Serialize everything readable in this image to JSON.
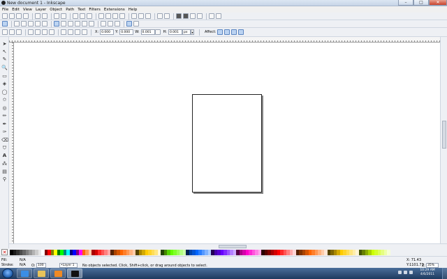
{
  "window": {
    "title": "New document 1 - Inkscape",
    "buttons": {
      "minimize": "–",
      "maximize": "□",
      "close": "✕"
    }
  },
  "menu": [
    "File",
    "Edit",
    "View",
    "Layer",
    "Object",
    "Path",
    "Text",
    "Filters",
    "Extensions",
    "Help"
  ],
  "toolbar": {
    "x_label": "X:",
    "x_value": "0.000",
    "y_label": "Y:",
    "y_value": "0.000",
    "w_label": "W:",
    "w_value": "0.001",
    "h_label": "H:",
    "h_value": "0.001",
    "unit": "px",
    "affect_label": "Affect:"
  },
  "tools": [
    "selector-icon",
    "node-icon",
    "tweak-icon",
    "zoom-icon",
    "rect-icon",
    "3dbox-icon",
    "ellipse-icon",
    "star-icon",
    "spiral-icon",
    "pencil-icon",
    "pen-icon",
    "calligraphy-icon",
    "text-icon",
    "spray-icon",
    "eraser-icon",
    "bucket-icon",
    "gradient-icon",
    "dropper-icon"
  ],
  "palette": {
    "colors": [
      "#000000",
      "#1a1a1a",
      "#333333",
      "#4d4d4d",
      "#666666",
      "#808080",
      "#999999",
      "#b3b3b3",
      "#cccccc",
      "#e6e6e6",
      "#ffffff",
      "#800000",
      "#ff0000",
      "#808000",
      "#ffff00",
      "#008000",
      "#00ff00",
      "#008080",
      "#00ffff",
      "#000080",
      "#0000ff",
      "#800080",
      "#ff00ff",
      "#ff6600",
      "#ff9955",
      "#ffccaa",
      "#aa0000",
      "#d40000",
      "#ff2a2a",
      "#ff5555",
      "#ff8080",
      "#ffaaaa",
      "#552200",
      "#aa4400",
      "#d45500",
      "#ff6600",
      "#ff7f2a",
      "#ff9955",
      "#ffb380",
      "#ffccaa",
      "#554400",
      "#aa8800",
      "#d4aa00",
      "#ffcc00",
      "#ffd42a",
      "#ffdd55",
      "#ffe680",
      "#fff6d5",
      "#224400",
      "#448800",
      "#55d400",
      "#66ff00",
      "#7fff2a",
      "#99ff55",
      "#b3ff80",
      "#ccffaa",
      "#002255",
      "#0044aa",
      "#0055d4",
      "#0066ff",
      "#2a7fff",
      "#5599ff",
      "#80b3ff",
      "#aaccff",
      "#220055",
      "#4400aa",
      "#5500d4",
      "#6600ff",
      "#7f2aff",
      "#9955ff",
      "#b380ff",
      "#ccaaff",
      "#550044",
      "#aa0088",
      "#d400aa",
      "#ff00cc",
      "#ff2ad4",
      "#ff55dd",
      "#ff80e5",
      "#ffaaee",
      "#2b0000",
      "#550000",
      "#800000",
      "#aa0000",
      "#d40000",
      "#ff0000",
      "#ff2a2a",
      "#ff5555",
      "#ff8080",
      "#ffaaaa",
      "#ffd5d5",
      "#552200",
      "#803300",
      "#aa4400",
      "#d45500",
      "#ff6600",
      "#ff7f2a",
      "#ff9955",
      "#ffb380",
      "#ffccaa",
      "#ffe6d5",
      "#554400",
      "#806600",
      "#aa8800",
      "#d4aa00",
      "#ffcc00",
      "#ffd42a",
      "#ffdd55",
      "#ffe680",
      "#ffeeaa",
      "#fff6d5",
      "#445500",
      "#668000",
      "#88aa00",
      "#aad400",
      "#ccff00",
      "#d4ff2a",
      "#ddff55",
      "#e5ff80",
      "#eeffaa",
      "#f6ffd5"
    ]
  },
  "status": {
    "fill_label": "Fill:",
    "fill_value": "N/A",
    "stroke_label": "Stroke:",
    "stroke_value": "N/A",
    "opacity_label": "O:",
    "opacity_value": "100",
    "layer": "•Layer 1",
    "message": "No objects selected. Click, Shift+click, or drag around objects to select.",
    "x_coord": "X: 71.43",
    "y_coord": "Y:1101.71",
    "zoom_label": "Z:",
    "zoom": "35%"
  },
  "taskbar": {
    "time": "10:29 AM",
    "date": "4/6/2011"
  }
}
